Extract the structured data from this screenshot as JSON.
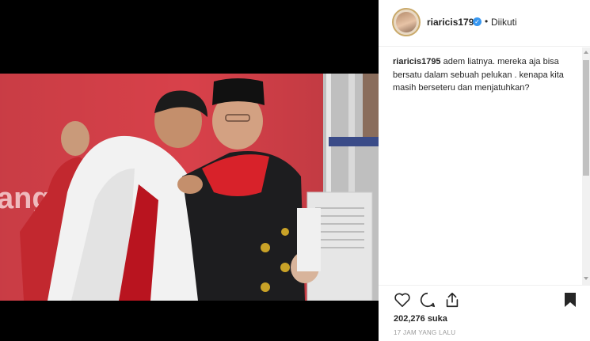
{
  "post": {
    "username": "riaricis1795",
    "verified_icon": "verified-badge-icon",
    "separator": "•",
    "follow_status": "Diikuti",
    "caption_user": "riaricis1795",
    "caption_text": "adem liatnya. mereka aja bisa bersatu dalam sebuah pelukan . kenapa kita masih berseteru dan menjatuhkan?",
    "likes": "202,276 suka",
    "timestamp": "17 JAM YANG LALU"
  },
  "media": {
    "backdrop_text": "ang",
    "description": ""
  },
  "actions": {
    "like_icon": "heart-icon",
    "comment_icon": "comment-icon",
    "share_icon": "share-icon",
    "save_icon": "bookmark-icon"
  },
  "colors": {
    "backdrop_red": "#d8414a",
    "verified_blue": "#3897f0",
    "text_dark": "#262626",
    "text_muted": "#999999"
  }
}
